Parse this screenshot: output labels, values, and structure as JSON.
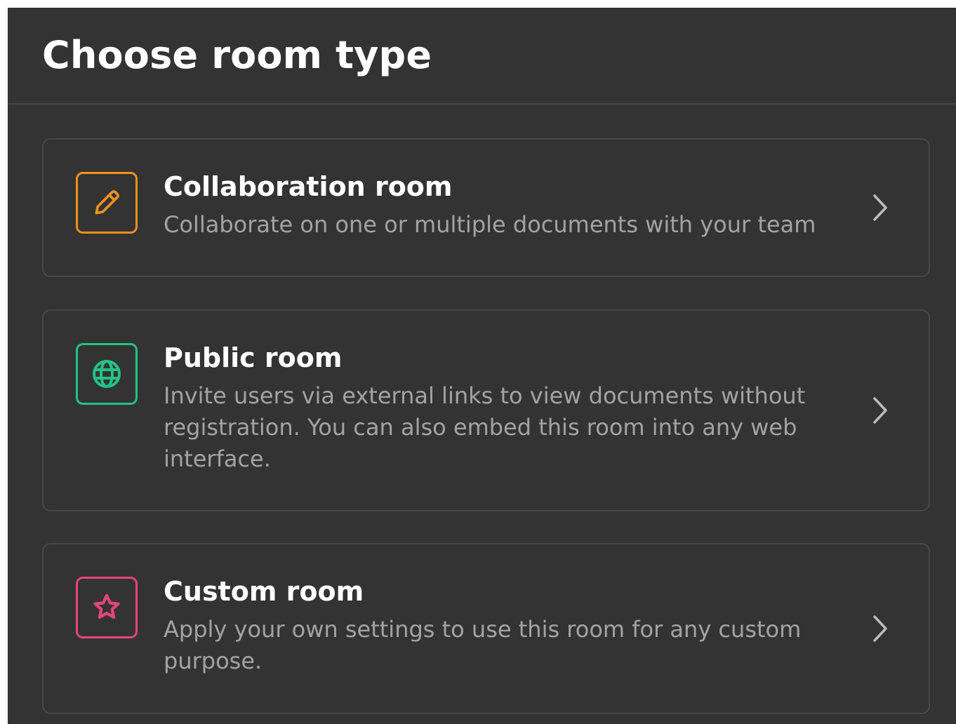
{
  "dialog": {
    "title": "Choose room type"
  },
  "colors": {
    "background": "#333333",
    "border": "#474747",
    "title_text": "#ffffff",
    "description_text": "#a3a3a3",
    "collaboration_accent": "#f2911b",
    "public_accent": "#22c386",
    "custom_accent": "#e6467a"
  },
  "rooms": [
    {
      "name": "Collaboration room",
      "description": "Collaborate on one or multiple documents with your team",
      "icon": "pencil-icon",
      "accent": "#f2911b"
    },
    {
      "name": "Public room",
      "description": "Invite users via external links to view documents without registration. You can also embed this room into any web interface.",
      "icon": "globe-icon",
      "accent": "#22c386"
    },
    {
      "name": "Custom room",
      "description": "Apply your own settings to use this room for any custom purpose.",
      "icon": "star-icon",
      "accent": "#e6467a"
    }
  ]
}
